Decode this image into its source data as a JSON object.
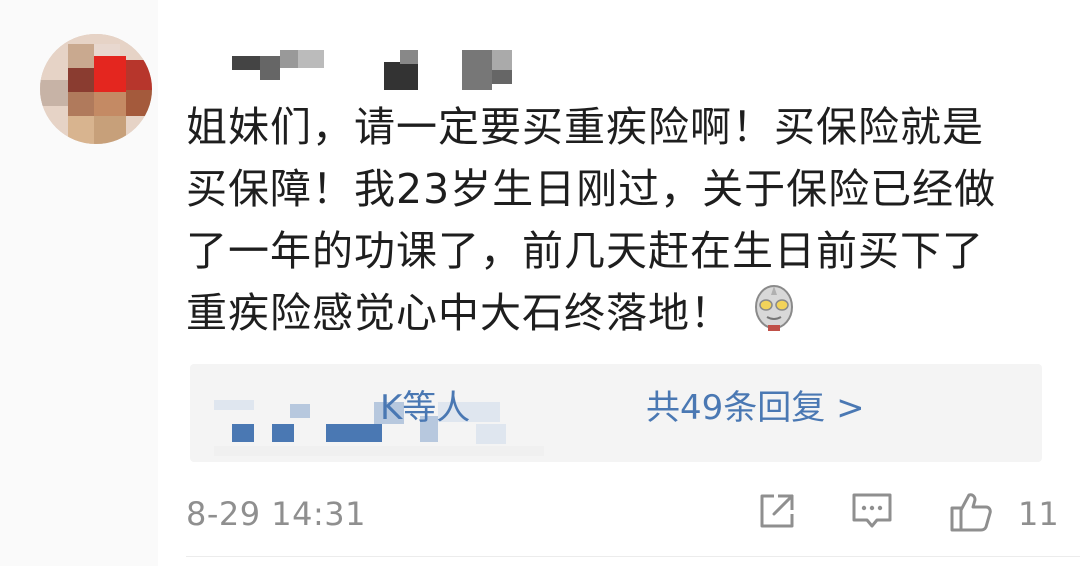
{
  "comment": {
    "lines": [
      "姐妹们，请一定要买重疾险啊！买保险就是",
      "买保障！我23岁生日刚过，关于保险已经做",
      "了一年的功课了，前几天赶在生日前买下了",
      "重疾险感觉心中大石终落地！"
    ],
    "emoji": "ultraman-emoji"
  },
  "replies": {
    "names_suffix": "K等人",
    "count_label": "共49条回复 >"
  },
  "footer": {
    "timestamp": "8-29 14:31",
    "like_count": "11"
  },
  "icons": {
    "share": "share-icon",
    "comment": "comment-icon",
    "like": "thumbs-up-icon"
  },
  "colors": {
    "link": "#4a78b3",
    "meta": "#8f8f8f",
    "text": "#1e1e1e",
    "reply_bg": "#f4f4f4"
  }
}
